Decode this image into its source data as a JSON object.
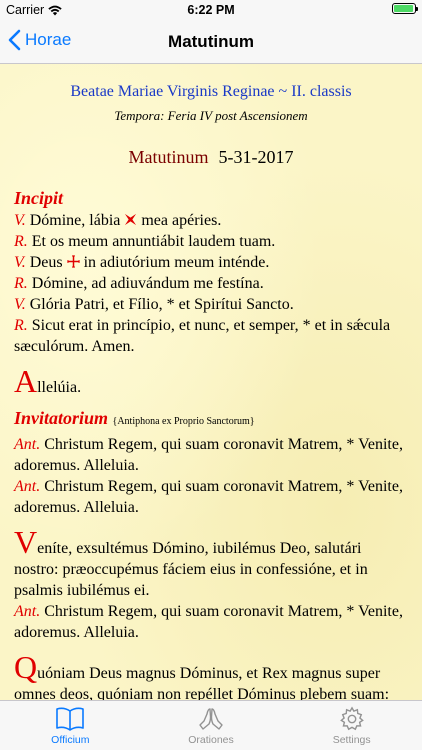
{
  "status": {
    "carrier": "Carrier",
    "time": "6:22 PM"
  },
  "nav": {
    "back_label": "Horae",
    "title": "Matutinum"
  },
  "header": {
    "feast": "Beatae Mariae Virginis Reginae ~ II. classis",
    "tempora": "Tempora: Feria IV post Ascensionem",
    "hour": "Matutinum",
    "date": "5-31-2017"
  },
  "incipit": {
    "title": "Incipit",
    "v1_mark": "V.",
    "v1_a": "Dómine, lábia",
    "v1_b": "mea apéries.",
    "r1_mark": "R.",
    "r1": "Et os meum annuntiábit laudem tuam.",
    "v2_mark": "V.",
    "v2_a": "Deus",
    "v2_b": "in adiutórium meum inténde.",
    "r2_mark": "R.",
    "r2": "Dómine, ad adiuvándum me festína.",
    "v3_mark": "V.",
    "v3": "Glória Patri, et Fílio, * et Spirítui Sancto.",
    "r3_mark": "R.",
    "r3": "Sicut erat in princípio, et nunc, et semper, * et in sǽcula sæculórum. Amen.",
    "alleluia_initial": "A",
    "alleluia_rest": "llelúia."
  },
  "invitatorium": {
    "title": "Invitatorium",
    "note": "{Antiphona ex Proprio Sanctorum}",
    "ant_mark": "Ant.",
    "ant1": "Christum Regem, qui suam coronavit Matrem, * Venite, adoremus. Alleluia.",
    "ant2": "Christum Regem, qui suam coronavit Matrem, * Venite, adoremus. Alleluia.",
    "p1_initial": "V",
    "p1_rest": "eníte, exsultémus Dómino, iubilémus Deo, salutári nostro: præoccupémus fáciem eius in confessióne, et in psalmis iubilémus ei.",
    "ant3": "Christum Regem, qui suam coronavit Matrem, * Venite, adoremus. Alleluia.",
    "p2_initial": "Q",
    "p2_rest": "uóniam Deus magnus Dóminus, et Rex magnus super omnes deos, quóniam non repéllet Dóminus plebem suam: quia in manu eius sunt omnes fines terræ, et altitúdines"
  },
  "tabs": [
    {
      "label": "Officium",
      "icon": "book-icon"
    },
    {
      "label": "Orationes",
      "icon": "praying-hands-icon"
    },
    {
      "label": "Settings",
      "icon": "gear-icon"
    }
  ],
  "colors": {
    "accent": "#0a7aff",
    "rubric": "#e00000",
    "feast": "#1a39c7",
    "background": "#fbf5c7"
  }
}
